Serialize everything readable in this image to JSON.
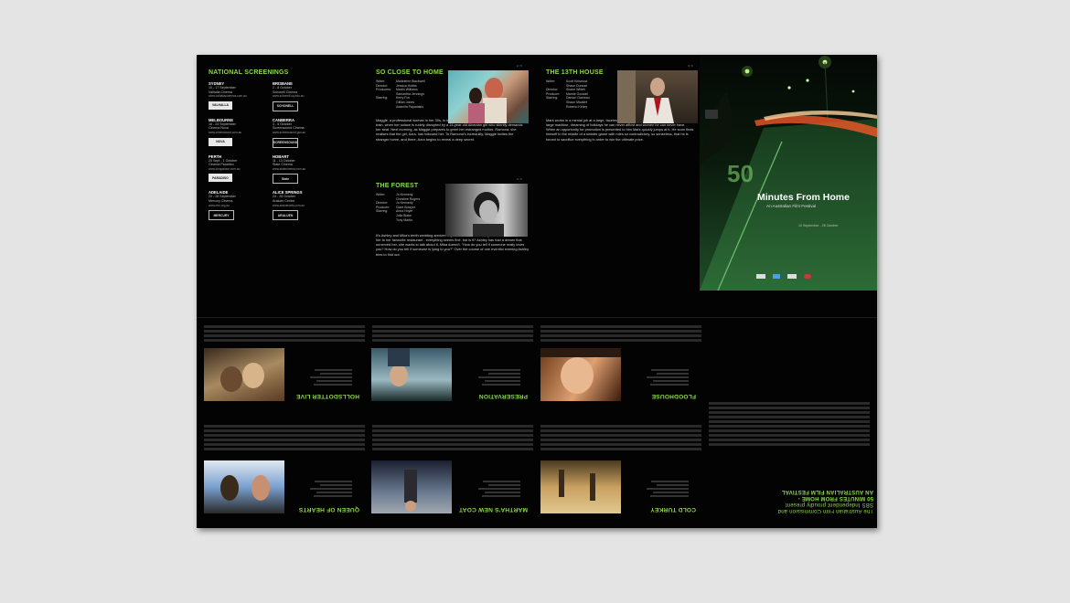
{
  "screenings": {
    "heading": "NATIONAL SCREENINGS",
    "cities": [
      {
        "name": "SYDNEY",
        "dates": "10 - 17 September",
        "venue": "Valhalla Cinema",
        "url": "www.valhallacinemas.com.au",
        "logo": "VALHALLA"
      },
      {
        "name": "BRISBANE",
        "dates": "2 - 8 October",
        "venue": "Schonell Cinema",
        "url": "www.schonell.uq.edu.au",
        "logo": "SCHONELL"
      },
      {
        "name": "MELBOURNE",
        "dates": "16 - 24 September",
        "venue": "Cinema Nova",
        "url": "www.cinemanova.com.au",
        "logo": "NOVA"
      },
      {
        "name": "CANBERRA",
        "dates": "3 - 5 October",
        "venue": "Screensound Cinema",
        "url": "www.screensound.gov.au",
        "logo": "SCREENSOUND"
      },
      {
        "name": "PERTH",
        "dates": "25 Sept - 1 October",
        "venue": "Cinema Paradiso",
        "url": "www.lunapalace.com.au",
        "logo": "PARADISO"
      },
      {
        "name": "HOBART",
        "dates": "11 - 13 October",
        "venue": "State Cinema",
        "url": "www.statecinema.com.au",
        "logo": "State"
      },
      {
        "name": "ADELAIDE",
        "dates": "20 - 28 September",
        "venue": "Mercury Cinema",
        "url": "www.mrc.org.au",
        "logo": "MERCURY"
      },
      {
        "name": "ALICE SPRINGS",
        "dates": "24 - 26 October",
        "venue": "Araluen Centre",
        "url": "www.araluenarts.com.au",
        "logo": "ARALUEN"
      }
    ]
  },
  "films": [
    {
      "title": "SO CLOSE TO HOME",
      "page": "2 / 6",
      "credits": [
        [
          "Writer:",
          "Madeleine Blackwell"
        ],
        [
          "Director:",
          "Jessica Hobbs"
        ],
        [
          "Producers:",
          "Martin Williams"
        ],
        [
          "",
          "Samantha Jennings"
        ],
        [
          "Starring:",
          "Kerry Fox"
        ],
        [
          "",
          "Gillian Jones"
        ],
        [
          "",
          "Adamlla Papadakis"
        ]
      ],
      "synopsis": "Maggie, a professional woman in her 30s, is in the sleeping compartment of an overnight train, when her solace is rudely disrupted by a 14-year-old Albanian girl who silently demands her seat. Next morning, as Maggie prepares to greet her estranged mother, Ramona, she realises that the girl, Azra, has followed her. To Ramona's incredulity, Maggie invites the stranger home, and there, Azra begins to reveal a deep secret."
    },
    {
      "title": "THE 13TH HOUSE",
      "page": "3 / 6",
      "credits": [
        [
          "Writer:",
          "Scott Kirkwood"
        ],
        [
          "",
          "Shaun Duncan"
        ],
        [
          "Director:",
          "Shane Willett"
        ],
        [
          "Producer:",
          "Marnie Goodall"
        ],
        [
          "Starring:",
          "Damon Gameau"
        ],
        [
          "",
          "Shaun Micallef"
        ],
        [
          "",
          "Roberto Kirkey"
        ]
      ],
      "synopsis": "Mark works in a menial job at a large, faceless corporation - just another cog in an impossibly large machine, dreaming of holidays he can never afford and women he can never have. When an opportunity for promotion is presented to him Mark quickly jumps at it. He soon finds himself in the middle of a sinister game with rules so contradictory, so senseless, that he is forced to sacrifice everything in order to win the ultimate prize."
    },
    {
      "title": "THE FOREST",
      "page": "2 / 6",
      "credits": [
        [
          "Writer:",
          "Jo Kennedy"
        ],
        [
          "",
          "Christine Rogers"
        ],
        [
          "Director:",
          "Jo Kennedy"
        ],
        [
          "Producer:",
          "Clare Bowyer"
        ],
        [
          "Starring:",
          "Anna Hoyle"
        ],
        [
          "",
          "Julia Blake"
        ],
        [
          "",
          "Tony Martin"
        ]
      ],
      "synopsis": "It's Ashley and Mika's tenth wedding anniversary. To celebrate Mika, buys her roses and takes her to her favourite restaurant - everything seems fine, but is it? Ashley has had a dream that unnerved her, she wants to talk about it, Mika doesn't. \"How do you tell if someone really loves you? How do you tell if someone is lying to you?\" Over the course of one eventful evening Ashley tries to find out."
    }
  ],
  "cover": {
    "title": "Minutes From Home",
    "subtitle": "An Australian Film Festival",
    "dates": "10 September - 26 October",
    "road_marking": "50"
  },
  "back_panels": [
    {
      "title": "HOLLSDOTTER LIVE"
    },
    {
      "title": "PRESERVATION"
    },
    {
      "title": "FLOODHOUSE"
    },
    {
      "title": "QUEEN OF HEARTS"
    },
    {
      "title": "MARTHA'S NEW COAT"
    },
    {
      "title": "COLD TURKEY"
    }
  ],
  "intro": {
    "lines": [
      "The Australian Film Commission and",
      "SBS Independent proudly present",
      "50 MINUTES FROM HOME -",
      "AN AUSTRALIAN FILM FESTIVAL"
    ]
  },
  "colors": {
    "accent": "#8bd94a",
    "paper": "#030303",
    "backdrop": "#e4e4e4"
  }
}
